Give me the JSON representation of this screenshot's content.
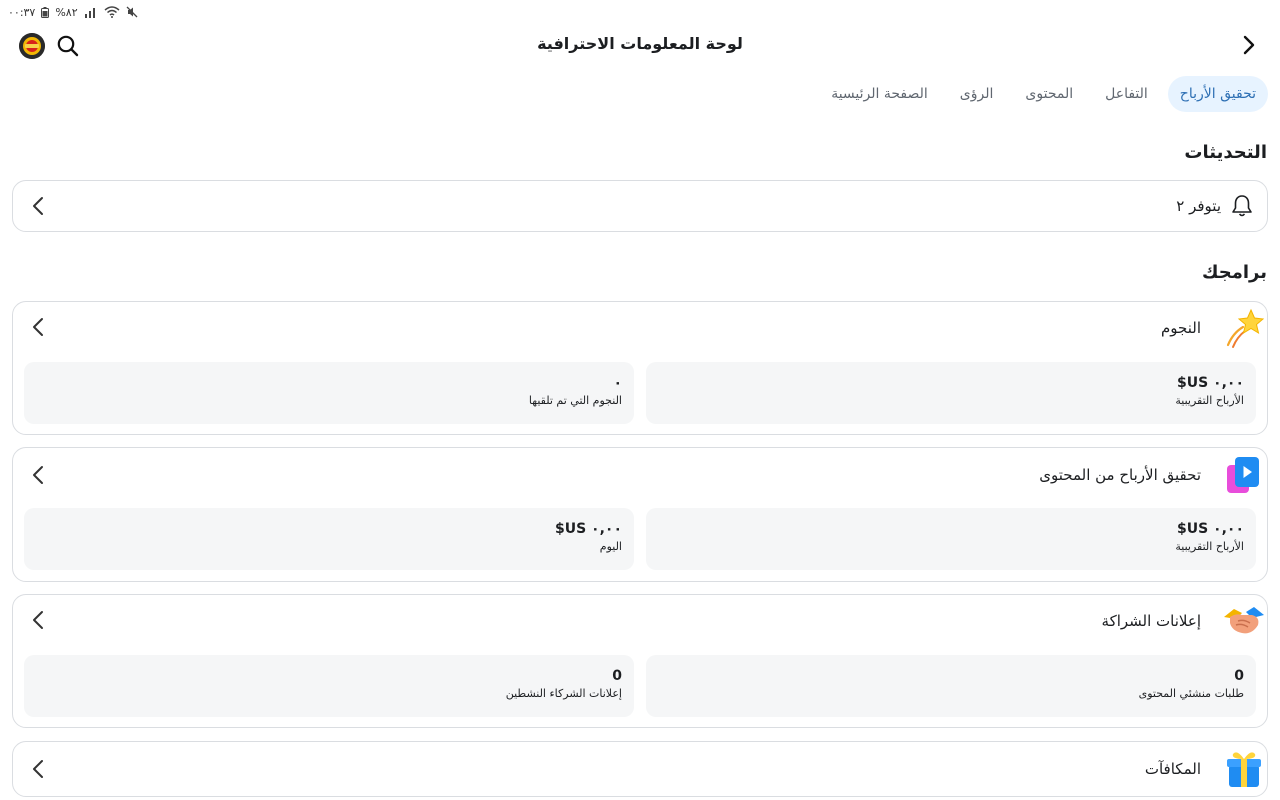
{
  "status_bar": {
    "time": "٠٠:٣٧",
    "battery": "%٨٢"
  },
  "header": {
    "title": "لوحة المعلومات الاحترافية"
  },
  "tabs": [
    {
      "label": "الصفحة الرئيسية",
      "active": false
    },
    {
      "label": "الرؤى",
      "active": false
    },
    {
      "label": "المحتوى",
      "active": false
    },
    {
      "label": "التفاعل",
      "active": false
    },
    {
      "label": "تحقيق الأرباح",
      "active": true
    }
  ],
  "updates": {
    "title": "التحديثات",
    "item_label": "يتوفر ٢"
  },
  "programs": {
    "title": "برامجك",
    "cards": [
      {
        "label": "النجوم",
        "icon": "shooting-star-icon",
        "stats": [
          {
            "value": "٠,٠٠ US$",
            "caption": "الأرباح التقريبية"
          },
          {
            "value": "٠",
            "caption": "النجوم التي تم تلقيها"
          }
        ]
      },
      {
        "label": "تحقيق الأرباح من المحتوى",
        "icon": "content-play-icon",
        "stats": [
          {
            "value": "٠,٠٠ US$",
            "caption": "الأرباح التقريبية"
          },
          {
            "value": "٠,٠٠ US$",
            "caption": "اليوم"
          }
        ]
      },
      {
        "label": "إعلانات الشراكة",
        "icon": "handshake-icon",
        "stats": [
          {
            "value": "0",
            "caption": "طلبات منشئي المحتوى"
          },
          {
            "value": "0",
            "caption": "إعلانات الشركاء النشطين"
          }
        ]
      },
      {
        "label": "المكافآت",
        "icon": "gift-icon"
      }
    ]
  }
}
